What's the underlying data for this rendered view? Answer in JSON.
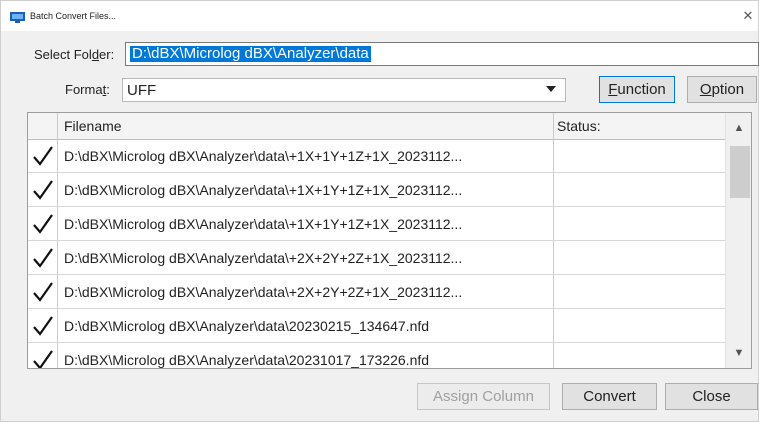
{
  "window": {
    "title": "Batch Convert Files..."
  },
  "form": {
    "folder_label": {
      "pre": "Select Fol",
      "u": "d",
      "post": "er:"
    },
    "folder_value": "D:\\dBX\\Microlog dBX\\Analyzer\\data",
    "format_label": {
      "pre": "Forma",
      "u": "t",
      "post": ":"
    },
    "format_value": "UFF"
  },
  "buttons": {
    "function": {
      "u": "F",
      "rest": "unction"
    },
    "option": {
      "u": "O",
      "rest": "ption"
    },
    "assign_column": "Assign Column",
    "convert": "Convert",
    "close": "Close"
  },
  "table": {
    "columns": {
      "filename": "Filename",
      "status": "Status:"
    },
    "rows": [
      {
        "filename": "D:\\dBX\\Microlog dBX\\Analyzer\\data\\+1X+1Y+1Z+1X_2023112...",
        "status": "",
        "checked": true
      },
      {
        "filename": "D:\\dBX\\Microlog dBX\\Analyzer\\data\\+1X+1Y+1Z+1X_2023112...",
        "status": "",
        "checked": true
      },
      {
        "filename": "D:\\dBX\\Microlog dBX\\Analyzer\\data\\+1X+1Y+1Z+1X_2023112...",
        "status": "",
        "checked": true
      },
      {
        "filename": "D:\\dBX\\Microlog dBX\\Analyzer\\data\\+2X+2Y+2Z+1X_2023112...",
        "status": "",
        "checked": true
      },
      {
        "filename": "D:\\dBX\\Microlog dBX\\Analyzer\\data\\+2X+2Y+2Z+1X_2023112...",
        "status": "",
        "checked": true
      },
      {
        "filename": "D:\\dBX\\Microlog dBX\\Analyzer\\data\\20230215_134647.nfd",
        "status": "",
        "checked": true
      },
      {
        "filename": "D:\\dBX\\Microlog dBX\\Analyzer\\data\\20231017_173226.nfd",
        "status": "",
        "checked": true
      }
    ]
  },
  "icons": {
    "app": "dialog-app-icon",
    "close": "close-icon",
    "checkmark": "checkmark-icon"
  },
  "colors": {
    "selection": "#0078d7",
    "accent_border": "#0078d7",
    "disabled_text": "#a0a0a0"
  }
}
